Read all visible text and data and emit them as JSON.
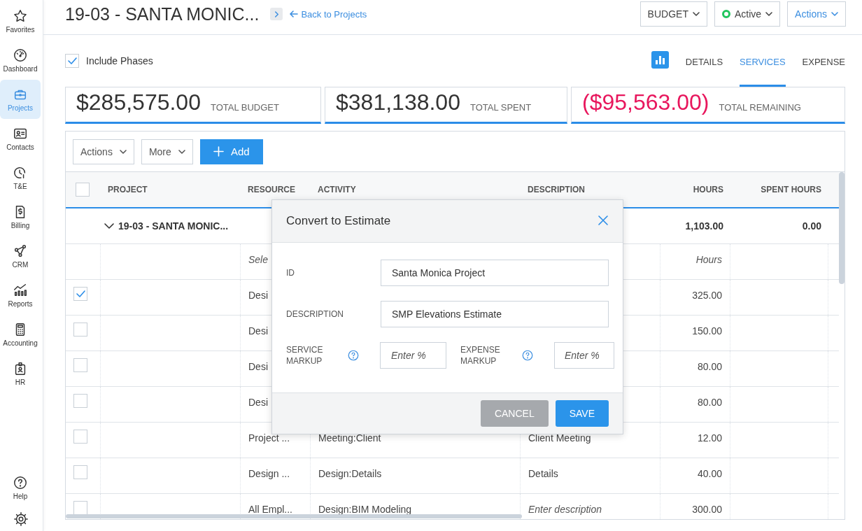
{
  "sidebar": {
    "items": [
      {
        "label": "Favorites",
        "selected": false
      },
      {
        "label": "Dashboard",
        "selected": false
      },
      {
        "label": "Projects",
        "selected": true
      },
      {
        "label": "Contacts",
        "selected": false
      },
      {
        "label": "T&E",
        "selected": false
      },
      {
        "label": "Billing",
        "selected": false
      },
      {
        "label": "CRM",
        "selected": false
      },
      {
        "label": "Reports",
        "selected": false
      },
      {
        "label": "Accounting",
        "selected": false
      },
      {
        "label": "HR",
        "selected": false
      }
    ],
    "bottom_items": [
      {
        "label": "Help"
      }
    ]
  },
  "header": {
    "title": "19-03 - SANTA MONIC...",
    "back_link": "Back to Projects",
    "view_menu": "BUDGET",
    "status": {
      "label": "Active",
      "color": "#22c55e"
    },
    "actions_menu": "Actions"
  },
  "include_phases": {
    "label": "Include Phases",
    "checked": true
  },
  "tabs": [
    {
      "label": "DETAILS",
      "selected": false
    },
    {
      "label": "SERVICES",
      "selected": true
    },
    {
      "label": "EXPENSE",
      "selected": false
    }
  ],
  "summary": [
    {
      "amount": "$285,575.00",
      "label": "TOTAL BUDGET",
      "negative": false
    },
    {
      "amount": "$381,138.00",
      "label": "TOTAL SPENT",
      "negative": false
    },
    {
      "amount": "($95,563.00)",
      "label": "TOTAL REMAINING",
      "negative": true
    }
  ],
  "toolbar": {
    "actions": "Actions",
    "more": "More",
    "add": "Add"
  },
  "table": {
    "select_all_checked": false,
    "columns": [
      "PROJECT",
      "RESOURCE",
      "ACTIVITY",
      "DESCRIPTION",
      "HOURS",
      "SPENT HOURS"
    ],
    "group_row": {
      "project": "19-03 - SANTA MONIC...",
      "hours": "1,103.00",
      "spent_hours": "0.00",
      "expanded": true
    },
    "rows": [
      {
        "kind": "new",
        "resource_placeholder": "Sele",
        "hours_placeholder": "Hours"
      },
      {
        "kind": "entry",
        "checked": true,
        "resource": "Desi",
        "hours": "325.00"
      },
      {
        "kind": "entry",
        "checked": false,
        "resource": "Desi",
        "hours": "150.00"
      },
      {
        "kind": "entry",
        "checked": false,
        "resource": "Desi",
        "hours": "80.00"
      },
      {
        "kind": "entry",
        "checked": false,
        "resource": "Desi",
        "hours": "80.00"
      },
      {
        "kind": "entry",
        "checked": false,
        "resource": "Project ...",
        "activity": "Meeting:Client",
        "description": "Client Meeting",
        "hours": "12.00"
      },
      {
        "kind": "entry",
        "checked": false,
        "resource": "Design ...",
        "activity": "Design:Details",
        "description": "Details",
        "hours": "40.00"
      },
      {
        "kind": "entry",
        "checked": false,
        "resource": "All Empl...",
        "activity": "Design:BIM Modeling",
        "description_placeholder": "Enter description",
        "hours": "300.00"
      }
    ]
  },
  "modal": {
    "title": "Convert to Estimate",
    "fields": [
      {
        "label": "ID",
        "value": "Santa Monica Project"
      },
      {
        "label": "DESCRIPTION",
        "value": "SMP Elevations Estimate"
      }
    ],
    "markups": [
      {
        "label": "SERVICE MARKUP",
        "placeholder": "Enter %"
      },
      {
        "label": "EXPENSE MARKUP",
        "placeholder": "Enter %"
      }
    ],
    "buttons": [
      {
        "label": "CANCEL",
        "kind": "secondary"
      },
      {
        "label": "SAVE",
        "kind": "primary"
      }
    ]
  }
}
